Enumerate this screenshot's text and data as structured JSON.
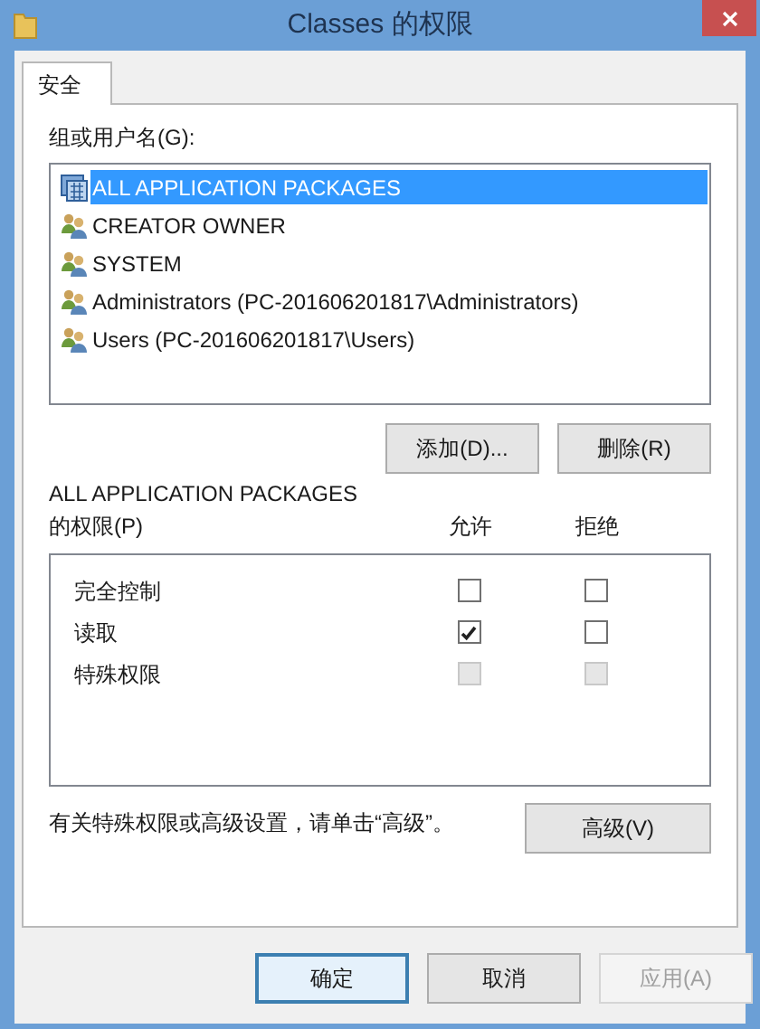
{
  "window": {
    "title": "Classes 的权限"
  },
  "tabs": [
    {
      "label": "安全",
      "selected": true
    }
  ],
  "principals": {
    "label": "组或用户名(G):",
    "items": [
      {
        "name": "ALL APPLICATION PACKAGES",
        "kind": "package",
        "selected": true
      },
      {
        "name": "CREATOR OWNER",
        "kind": "group",
        "selected": false
      },
      {
        "name": "SYSTEM",
        "kind": "group",
        "selected": false
      },
      {
        "name": "Administrators (PC-201606201817\\Administrators)",
        "kind": "group",
        "selected": false
      },
      {
        "name": "Users (PC-201606201817\\Users)",
        "kind": "group",
        "selected": false
      }
    ]
  },
  "principal_buttons": [
    {
      "label": "添加(D)..."
    },
    {
      "label": "删除(R)"
    }
  ],
  "permissions": {
    "subject": "ALL APPLICATION PACKAGES",
    "label": "的权限(P)",
    "columns": [
      "允许",
      "拒绝"
    ],
    "rows": [
      {
        "name": "完全控制",
        "allow": {
          "checked": false,
          "disabled": false
        },
        "deny": {
          "checked": false,
          "disabled": false
        }
      },
      {
        "name": "读取",
        "allow": {
          "checked": true,
          "disabled": false
        },
        "deny": {
          "checked": false,
          "disabled": false
        }
      },
      {
        "name": "特殊权限",
        "allow": {
          "checked": false,
          "disabled": true
        },
        "deny": {
          "checked": false,
          "disabled": true
        }
      }
    ]
  },
  "advanced": {
    "note": "有关特殊权限或高级设置，请单击“高级”。",
    "button": "高级(V)"
  },
  "footer_buttons": [
    {
      "label": "确定",
      "default": true,
      "disabled": false
    },
    {
      "label": "取消",
      "default": false,
      "disabled": false
    },
    {
      "label": "应用(A)",
      "default": false,
      "disabled": true
    }
  ]
}
